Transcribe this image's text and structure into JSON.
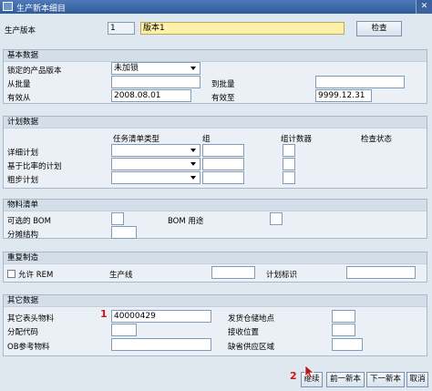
{
  "window": {
    "title": "生产新本细目",
    "close_icon": "close-icon"
  },
  "header": {
    "version_label": "生产版本",
    "version_number": "1",
    "version_text": "版本1",
    "check_button": "检查"
  },
  "basic": {
    "title": "基本数据",
    "lock_label": "锁定的产品版本",
    "lock_value": "未加锁",
    "from_lot_label": "从批量",
    "from_lot_value": "",
    "to_lot_label": "到批量",
    "to_lot_value": "",
    "valid_from_label": "有效从",
    "valid_from_value": "2008.08.01",
    "valid_to_label": "有效至",
    "valid_to_value": "9999.12.31"
  },
  "planning": {
    "title": "计划数据",
    "col_task_type": "任务清单类型",
    "col_group": "组",
    "col_group_counter": "组计数器",
    "col_check_status": "检查状态",
    "rows": [
      {
        "label": "详细计划",
        "task_type": "",
        "group": "",
        "counter": ""
      },
      {
        "label": "基于比率的计划",
        "task_type": "",
        "group": "",
        "counter": ""
      },
      {
        "label": "粗步计划",
        "task_type": "",
        "group": "",
        "counter": ""
      }
    ]
  },
  "bom": {
    "title": "物料清单",
    "alt_bom_label": "可选的 BOM",
    "alt_bom_value": "",
    "bom_usage_label": "BOM 用途",
    "bom_usage_value": "",
    "apportion_label": "分摊结构",
    "apportion_value": ""
  },
  "repetitive": {
    "title": "重复制造",
    "allow_rem_label": "允许 REM",
    "prod_line_label": "生产线",
    "prod_line_value": "",
    "plan_id_label": "计划标识",
    "plan_id_value": ""
  },
  "other": {
    "title": "其它数据",
    "other_header_material_label": "其它表头物料",
    "other_header_material_value": "40000429",
    "issue_storage_label": "发货仓储地点",
    "issue_storage_value": "",
    "dist_key_label": "分配代码",
    "dist_key_value": "",
    "receive_storage_label": "接收位置",
    "receive_storage_value": "",
    "ob_ref_material_label": "OB参考物料",
    "ob_ref_material_value": "",
    "default_supply_label": "缺省供应区域",
    "default_supply_value": ""
  },
  "annotations": {
    "marker1": "1",
    "marker2": "2"
  },
  "footer": {
    "continue_button": "继续",
    "prev_button": "前一新本",
    "next_button": "下一新本",
    "cancel_button": "取消"
  }
}
